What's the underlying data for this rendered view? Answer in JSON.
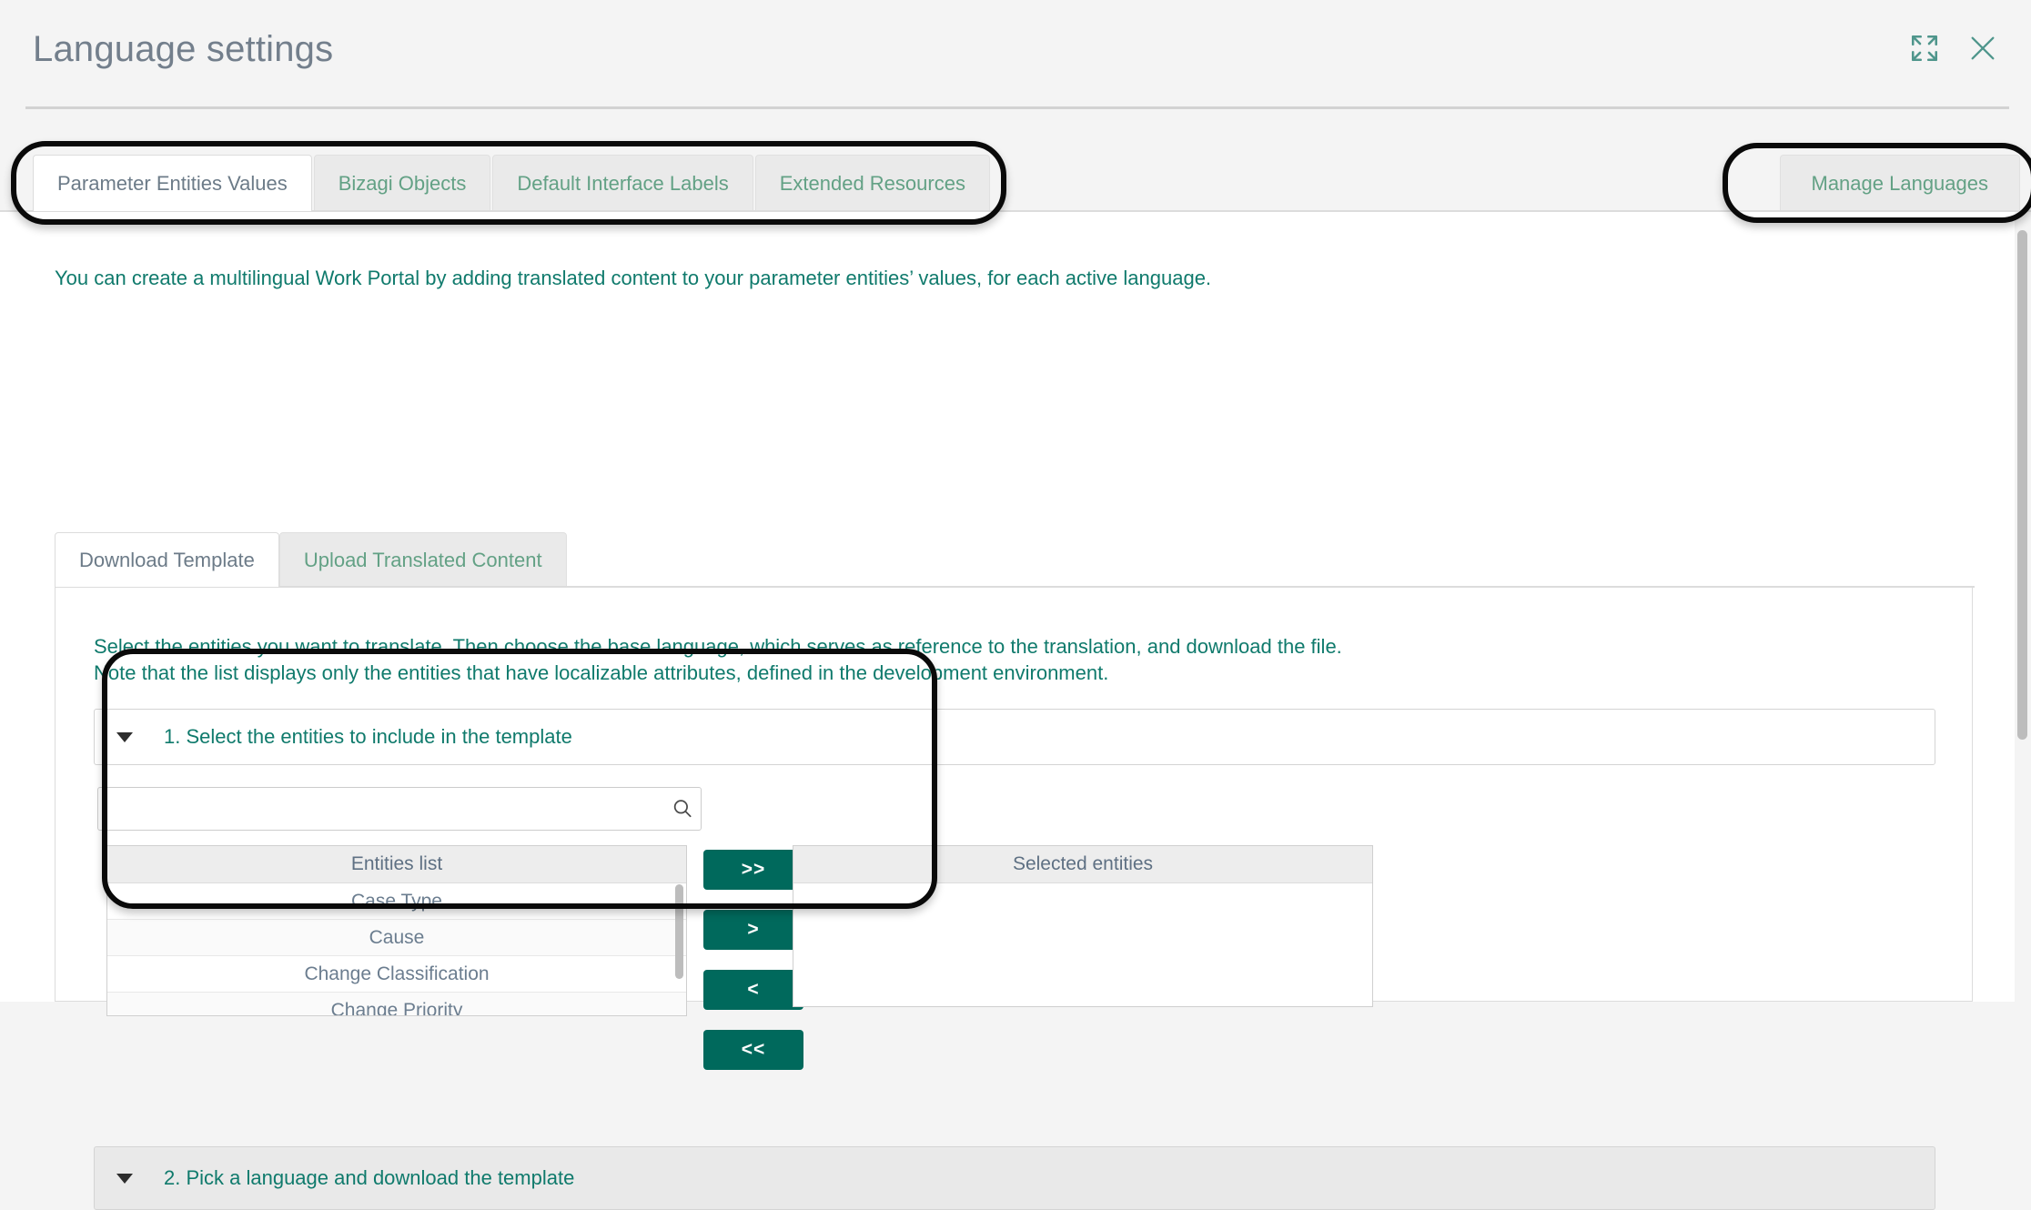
{
  "header": {
    "title": "Language settings",
    "expand_icon": "expand-fullscreen-icon",
    "close_icon": "close-icon"
  },
  "tabs": {
    "items": [
      {
        "label": "Parameter Entities Values",
        "active": true
      },
      {
        "label": "Bizagi Objects",
        "active": false
      },
      {
        "label": "Default Interface Labels",
        "active": false
      },
      {
        "label": "Extended Resources",
        "active": false
      }
    ],
    "right_tab": {
      "label": "Manage Languages",
      "active": false
    }
  },
  "content": {
    "intro": "You can create a multilingual Work Portal by adding translated content to your parameter entities’ values, for each active language.",
    "subtabs": [
      {
        "label": "Download Template",
        "active": true
      },
      {
        "label": "Upload Translated Content",
        "active": false
      }
    ],
    "instructions_line1": "Select the entities you want to translate. Then choose the base language, which serves as reference to the translation, and download the file.",
    "instructions_line2": "Note that the list displays only the entities that have localizable attributes, defined in the development environment.",
    "accordion_1": "1. Select the entities to include in the template",
    "accordion_2": "2. Pick a language and download the template",
    "search": {
      "value": "",
      "placeholder": "",
      "icon": "search-icon"
    },
    "entities_list": {
      "header": "Entities list",
      "rows": [
        "Case Type",
        "Cause",
        "Change Classification",
        "Change Priority"
      ]
    },
    "selected_entities": {
      "header": "Selected entities",
      "rows": []
    },
    "transfer_buttons": [
      {
        "label": ">>",
        "name": "move-all-right-button"
      },
      {
        "label": ">",
        "name": "move-right-button"
      },
      {
        "label": "<",
        "name": "move-left-button"
      },
      {
        "label": "<<",
        "name": "move-all-left-button"
      }
    ]
  },
  "colors": {
    "teal_button": "#00695c",
    "link_green": "#0f7a6c",
    "tab_green": "#63a185",
    "title_gray": "#737f8c",
    "page_bg": "#f4f4f4",
    "annotation": "#0a0a0a"
  }
}
